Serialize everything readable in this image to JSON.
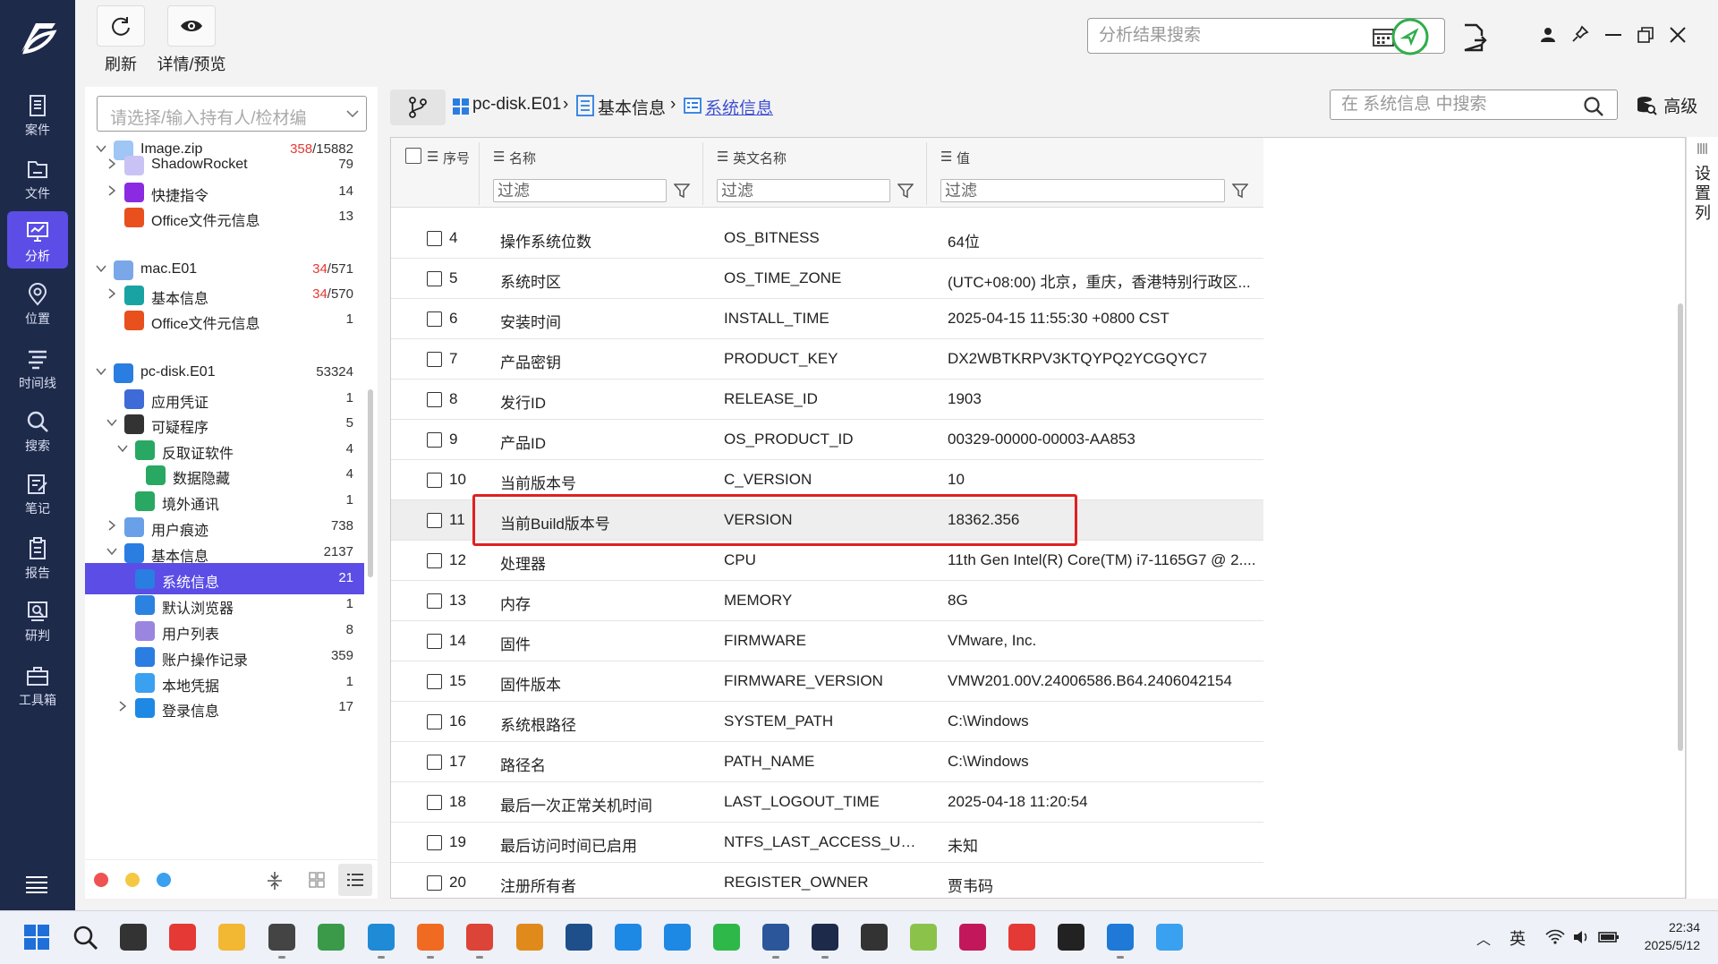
{
  "nav": {
    "items": [
      {
        "label": "案件",
        "icon": "case-icon"
      },
      {
        "label": "文件",
        "icon": "folder-icon"
      },
      {
        "label": "分析",
        "icon": "analysis-icon"
      },
      {
        "label": "位置",
        "icon": "location-icon"
      },
      {
        "label": "时间线",
        "icon": "timeline-icon"
      },
      {
        "label": "搜索",
        "icon": "search-icon"
      },
      {
        "label": "笔记",
        "icon": "note-icon"
      },
      {
        "label": "报告",
        "icon": "report-icon"
      },
      {
        "label": "研判",
        "icon": "judge-icon"
      },
      {
        "label": "工具箱",
        "icon": "toolbox-icon"
      }
    ],
    "active_index": 2
  },
  "toolbar": {
    "refresh_label": "刷新",
    "preview_label": "详情/预览",
    "search_placeholder": "分析结果搜索"
  },
  "tree": {
    "select_placeholder": "请选择/输入持有人/检材编",
    "items": [
      {
        "label": "Image.zip",
        "count_red": "358",
        "count": "/15882"
      },
      {
        "label": "ShadowRocket",
        "count": "79"
      },
      {
        "label": "快捷指令",
        "count": "14"
      },
      {
        "label": "Office文件元信息",
        "count": "13"
      },
      {
        "label": "mac.E01",
        "count_red": "34",
        "count": "/571"
      },
      {
        "label": "基本信息",
        "count_red": "34",
        "count": "/570"
      },
      {
        "label": "Office文件元信息",
        "count": "1"
      },
      {
        "label": "pc-disk.E01",
        "count": "53324"
      },
      {
        "label": "应用凭证",
        "count": "1"
      },
      {
        "label": "可疑程序",
        "count": "5"
      },
      {
        "label": "反取证软件",
        "count": "4"
      },
      {
        "label": "数据隐藏",
        "count": "4"
      },
      {
        "label": "境外通讯",
        "count": "1"
      },
      {
        "label": "用户痕迹",
        "count": "738"
      },
      {
        "label": "基本信息",
        "count": "2137"
      },
      {
        "label": "系统信息",
        "count": "21"
      },
      {
        "label": "默认浏览器",
        "count": "1"
      },
      {
        "label": "用户列表",
        "count": "8"
      },
      {
        "label": "账户操作记录",
        "count": "359"
      },
      {
        "label": "本地凭据",
        "count": "1"
      },
      {
        "label": "登录信息",
        "count": "17"
      }
    ]
  },
  "breadcrumb": {
    "items": [
      "pc-disk.E01",
      "基本信息",
      "系统信息"
    ],
    "search_placeholder": "在 系统信息 中搜索",
    "advanced_label": "高级"
  },
  "grid": {
    "headers": [
      "序号",
      "名称",
      "英文名称",
      "值"
    ],
    "filter_placeholder": "过滤",
    "rows": [
      {
        "no": "4",
        "name": "操作系统位数",
        "en": "OS_BITNESS",
        "val": "64位"
      },
      {
        "no": "5",
        "name": "系统时区",
        "en": "OS_TIME_ZONE",
        "val": "(UTC+08:00) 北京，重庆，香港特别行政区..."
      },
      {
        "no": "6",
        "name": "安装时间",
        "en": "INSTALL_TIME",
        "val": "2025-04-15 11:55:30 +0800 CST"
      },
      {
        "no": "7",
        "name": "产品密钥",
        "en": "PRODUCT_KEY",
        "val": "DX2WBTKRPV3KTQYPQ2YCGQYC7"
      },
      {
        "no": "8",
        "name": "发行ID",
        "en": "RELEASE_ID",
        "val": "1903"
      },
      {
        "no": "9",
        "name": "产品ID",
        "en": "OS_PRODUCT_ID",
        "val": "00329-00000-00003-AA853"
      },
      {
        "no": "10",
        "name": "当前版本号",
        "en": "C_VERSION",
        "val": "10"
      },
      {
        "no": "11",
        "name": "当前Build版本号",
        "en": "VERSION",
        "val": "18362.356"
      },
      {
        "no": "12",
        "name": "处理器",
        "en": "CPU",
        "val": "11th Gen Intel(R) Core(TM) i7-1165G7 @ 2...."
      },
      {
        "no": "13",
        "name": "内存",
        "en": "MEMORY",
        "val": "8G"
      },
      {
        "no": "14",
        "name": "固件",
        "en": "FIRMWARE",
        "val": "VMware, Inc."
      },
      {
        "no": "15",
        "name": "固件版本",
        "en": "FIRMWARE_VERSION",
        "val": "VMW201.00V.24006586.B64.2406042154"
      },
      {
        "no": "16",
        "name": "系统根路径",
        "en": "SYSTEM_PATH",
        "val": "C:\\Windows"
      },
      {
        "no": "17",
        "name": "路径名",
        "en": "PATH_NAME",
        "val": "C:\\Windows"
      },
      {
        "no": "18",
        "name": "最后一次正常关机时间",
        "en": "LAST_LOGOUT_TIME",
        "val": "2025-04-18 11:20:54"
      },
      {
        "no": "19",
        "name": "最后访问时间已启用",
        "en": "NTFS_LAST_ACCESS_UPDA...",
        "val": "未知"
      },
      {
        "no": "20",
        "name": "注册所有者",
        "en": "REGISTER_OWNER",
        "val": "贾韦码"
      }
    ],
    "highlight_row": "11"
  },
  "column_settings_label": "设置列",
  "taskbar": {
    "ime": "英",
    "time": "22:34",
    "date": "2025/5/12"
  },
  "colors": {
    "nav_bg": "#1e2a4a",
    "accent": "#5b4de6",
    "highlight_box": "#e02020",
    "count_red": "#e53935"
  }
}
